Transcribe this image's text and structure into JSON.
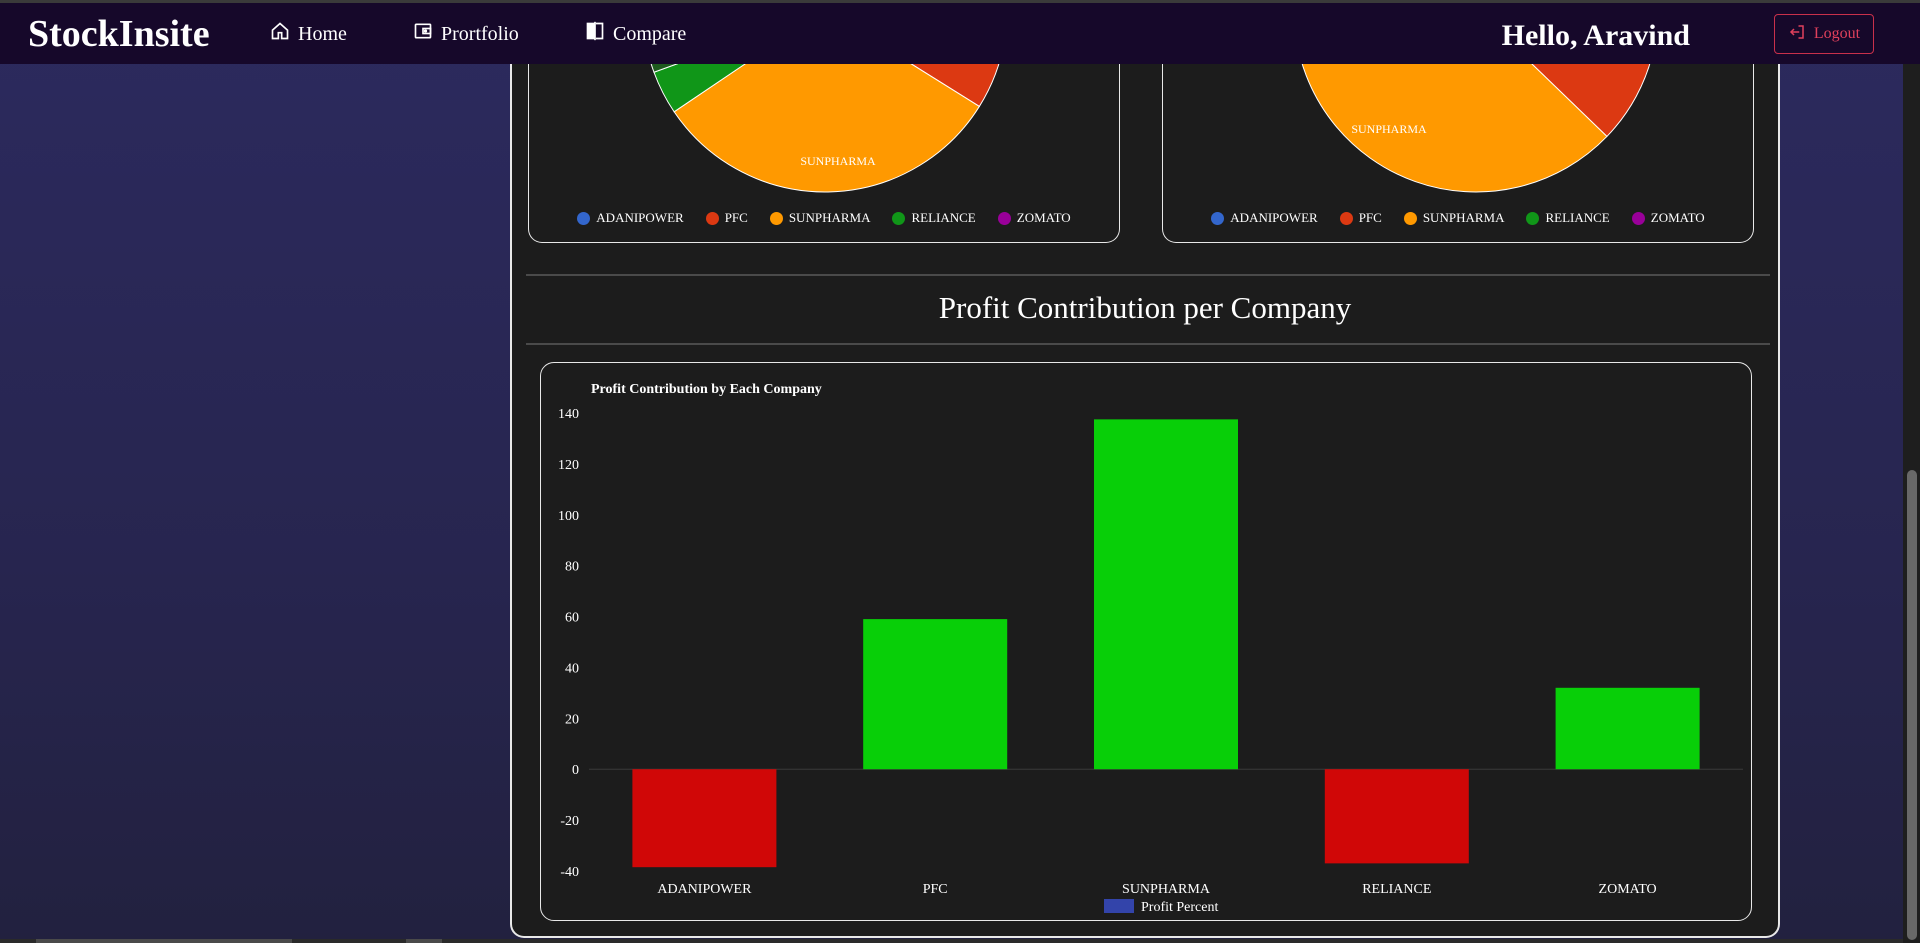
{
  "nav": {
    "brand": "StockInsite",
    "links": [
      {
        "label": "Home",
        "icon": "home-icon"
      },
      {
        "label": "Prortfolio",
        "icon": "wallet-icon"
      },
      {
        "label": "Compare",
        "icon": "compare-icon"
      }
    ],
    "greeting": "Hello, Aravind",
    "logout_label": "Logout"
  },
  "pies": {
    "legend": [
      {
        "label": "ADANIPOWER",
        "color": "#3366cc"
      },
      {
        "label": "PFC",
        "color": "#dc3912"
      },
      {
        "label": "SUNPHARMA",
        "color": "#ff9900"
      },
      {
        "label": "RELIANCE",
        "color": "#109618"
      },
      {
        "label": "ZOMATO",
        "color": "#990099"
      }
    ],
    "left_slice_label": "SUNPHARMA",
    "right_slice_label": "SUNPHARMA"
  },
  "section": {
    "title": "Profit Contribution per Company"
  },
  "chart_data": {
    "type": "bar",
    "title": "Profit Contribution by Each Company",
    "categories": [
      "ADANIPOWER",
      "PFC",
      "SUNPHARMA",
      "RELIANCE",
      "ZOMATO"
    ],
    "series": [
      {
        "name": "Profit Percent",
        "values": [
          -38.5,
          59,
          137.5,
          -37,
          32
        ]
      }
    ],
    "ylim": [
      -40,
      140
    ],
    "yticks": [
      140,
      120,
      100,
      80,
      60,
      40,
      20,
      0,
      -20,
      -40
    ],
    "positive_color": "#08cf08",
    "negative_color": "#d00707",
    "legend_color": "#3344aa",
    "grid": false,
    "legend_position": "bottom"
  }
}
